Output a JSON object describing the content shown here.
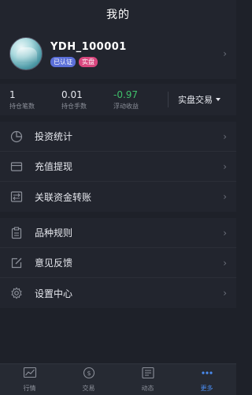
{
  "header": {
    "title": "我的"
  },
  "profile": {
    "username": "YDH_100001",
    "badges": [
      "已认证",
      "实盘"
    ]
  },
  "stats": [
    {
      "value": "1",
      "label": "持仓笔数"
    },
    {
      "value": "0.01",
      "label": "持仓手数"
    },
    {
      "value": "-0.97",
      "label": "浮动收益"
    }
  ],
  "trade_mode": {
    "label": "实盘交易"
  },
  "menu_group_1": [
    {
      "label": "投资统计",
      "icon": "pie-chart-icon"
    },
    {
      "label": "充值提现",
      "icon": "card-icon"
    },
    {
      "label": "关联资金转账",
      "icon": "transfer-icon"
    }
  ],
  "menu_group_2": [
    {
      "label": "品种规则",
      "icon": "clipboard-icon"
    },
    {
      "label": "意见反馈",
      "icon": "edit-icon"
    },
    {
      "label": "设置中心",
      "icon": "gear-icon"
    }
  ],
  "bottom_nav": [
    {
      "label": "行情",
      "icon": "chart-icon"
    },
    {
      "label": "交易",
      "icon": "dollar-icon"
    },
    {
      "label": "动态",
      "icon": "news-icon"
    },
    {
      "label": "更多",
      "icon": "more-icon",
      "active": true
    }
  ],
  "colors": {
    "accent": "#4a8cf0",
    "negative_value": "#3fbf6a",
    "badge_verified": "#5b6fd8",
    "badge_real": "#d8477e"
  }
}
